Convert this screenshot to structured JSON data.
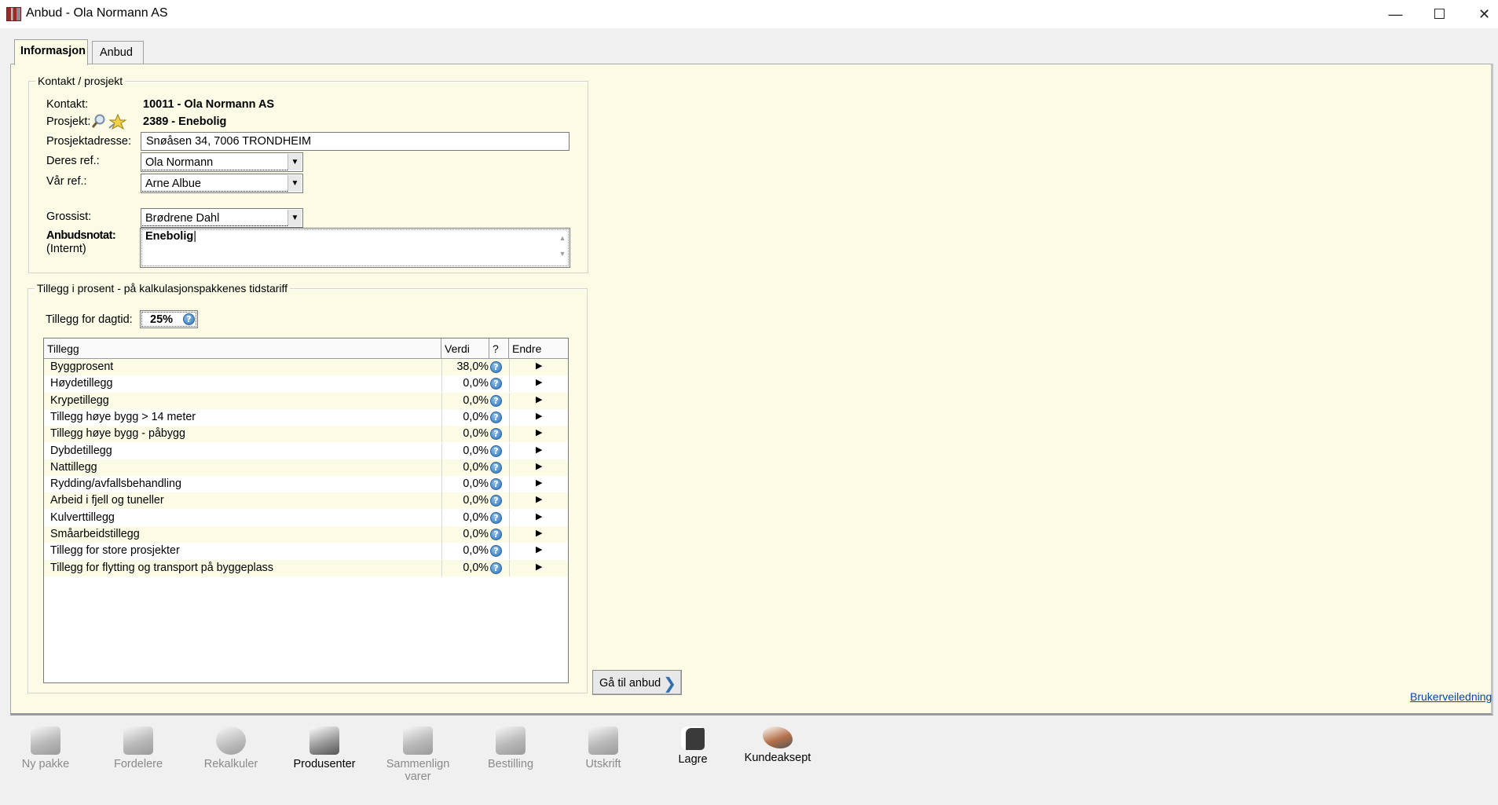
{
  "window": {
    "title": "Anbud - Ola Normann AS",
    "minimize_glyph": "—",
    "maximize_glyph": "☐",
    "close_glyph": "✕"
  },
  "tabs": [
    {
      "label": "Informasjon",
      "active": true
    },
    {
      "label": "Anbud",
      "active": false
    }
  ],
  "kontakt": {
    "legend": "Kontakt / prosjekt",
    "kontakt_label": "Kontakt:",
    "kontakt_value": "10011 - Ola Normann AS",
    "prosjekt_label": "Prosjekt:",
    "prosjekt_value": "2389 - Enebolig",
    "adresse_label": "Prosjektadresse:",
    "adresse_value": "Snøåsen 34, 7006 TRONDHEIM",
    "deres_ref_label": "Deres ref.:",
    "deres_ref_value": "Ola Normann",
    "var_ref_label": "Vår ref.:",
    "var_ref_value": "Arne Albue",
    "grossist_label": "Grossist:",
    "grossist_value": "Brødrene Dahl",
    "notat_label": "Anbudsnotat:",
    "notat_sublabel": "(Internt)",
    "notat_value": "Enebolig"
  },
  "tillegg": {
    "legend": "Tillegg i prosent - på kalkulasjonspakkenes tidstariff",
    "dagtid_label": "Tillegg for dagtid:",
    "dagtid_value": "25%",
    "columns": {
      "name": "Tillegg",
      "value": "Verdi",
      "help": "?",
      "edit": "Endre"
    },
    "rows": [
      {
        "name": "Byggprosent",
        "value": "38,0%"
      },
      {
        "name": "Høydetillegg",
        "value": "0,0%"
      },
      {
        "name": "Krypetillegg",
        "value": "0,0%"
      },
      {
        "name": "Tillegg høye bygg > 14 meter",
        "value": "0,0%"
      },
      {
        "name": "Tillegg høye bygg - påbygg",
        "value": "0,0%"
      },
      {
        "name": "Dybdetillegg",
        "value": "0,0%"
      },
      {
        "name": "Nattillegg",
        "value": "0,0%"
      },
      {
        "name": "Rydding/avfallsbehandling",
        "value": "0,0%"
      },
      {
        "name": "Arbeid i fjell og tuneller",
        "value": "0,0%"
      },
      {
        "name": "Kulverttillegg",
        "value": "0,0%"
      },
      {
        "name": "Småarbeidstillegg",
        "value": "0,0%"
      },
      {
        "name": "Tillegg for store prosjekter",
        "value": "0,0%"
      },
      {
        "name": "Tillegg for flytting og transport på byggeplass",
        "value": "0,0%"
      }
    ]
  },
  "goto_button": "Gå til anbud",
  "help_link": "Brukerveiledning",
  "toolbar": [
    {
      "label": "Ny pakke",
      "icon": "package-icon",
      "enabled": false,
      "color": "#8c8c8c"
    },
    {
      "label": "Fordelere",
      "icon": "distributor-icon",
      "enabled": false,
      "color": "#8c8c8c"
    },
    {
      "label": "Rekalkuler",
      "icon": "recalculate-icon",
      "enabled": false,
      "color": "#9a9a9a"
    },
    {
      "label": "Produsenter",
      "icon": "producers-icon",
      "enabled": true,
      "color": "#9a9a9a"
    },
    {
      "label": "Sammenlign varer",
      "icon": "scales-icon",
      "enabled": false,
      "color": "#8c8c8c"
    },
    {
      "label": "Bestilling",
      "icon": "order-icon",
      "enabled": false,
      "color": "#8c8c8c"
    },
    {
      "label": "Utskrift",
      "icon": "printer-icon",
      "enabled": false,
      "color": "#8c8c8c"
    },
    {
      "label": "Lagre",
      "icon": "save-icon",
      "enabled": true,
      "color": "#3a3a3a"
    },
    {
      "label": "Kundeaksept",
      "icon": "handshake-icon",
      "enabled": true,
      "color": "#b5714a"
    }
  ]
}
